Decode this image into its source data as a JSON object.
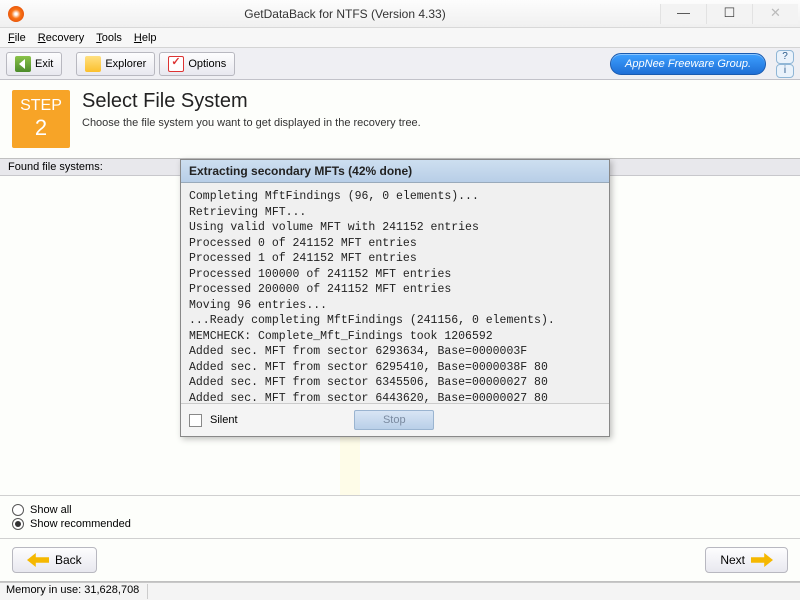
{
  "title": "GetDataBack for NTFS (Version 4.33)",
  "menu": {
    "file": "File",
    "recovery": "Recovery",
    "tools": "Tools",
    "help": "Help"
  },
  "toolbar": {
    "exit": "Exit",
    "explorer": "Explorer",
    "options": "Options"
  },
  "badge": "AppNee Freeware Group.",
  "step": {
    "word": "STEP",
    "num": "2"
  },
  "header": {
    "title": "Select File System",
    "sub": "Choose the file system you want to get displayed in the recovery tree."
  },
  "found_label": "Found file systems:",
  "dialog": {
    "title": "Extracting secondary MFTs (42% done)",
    "log": "Completing MftFindings (96, 0 elements)...\nRetrieving MFT...\nUsing valid volume MFT with 241152 entries\nProcessed 0 of 241152 MFT entries\nProcessed 1 of 241152 MFT entries\nProcessed 100000 of 241152 MFT entries\nProcessed 200000 of 241152 MFT entries\nMoving 96 entries...\n...Ready completing MftFindings (241156, 0 elements).\nMEMCHECK: Complete_Mft_Findings took 1206592\nAdded sec. MFT from sector 6293634, Base=0000003F\nAdded sec. MFT from sector 6295410, Base=0000038F 80\nAdded sec. MFT from sector 6345506, Base=00000027 80\nAdded sec. MFT from sector 6443620, Base=00000027 80",
    "silent": "Silent",
    "stop": "Stop"
  },
  "radios": {
    "show_all": "Show all",
    "show_recommended": "Show recommended"
  },
  "nav": {
    "back": "Back",
    "next": "Next"
  },
  "status": {
    "mem": "Memory in use: 31,628,708"
  }
}
